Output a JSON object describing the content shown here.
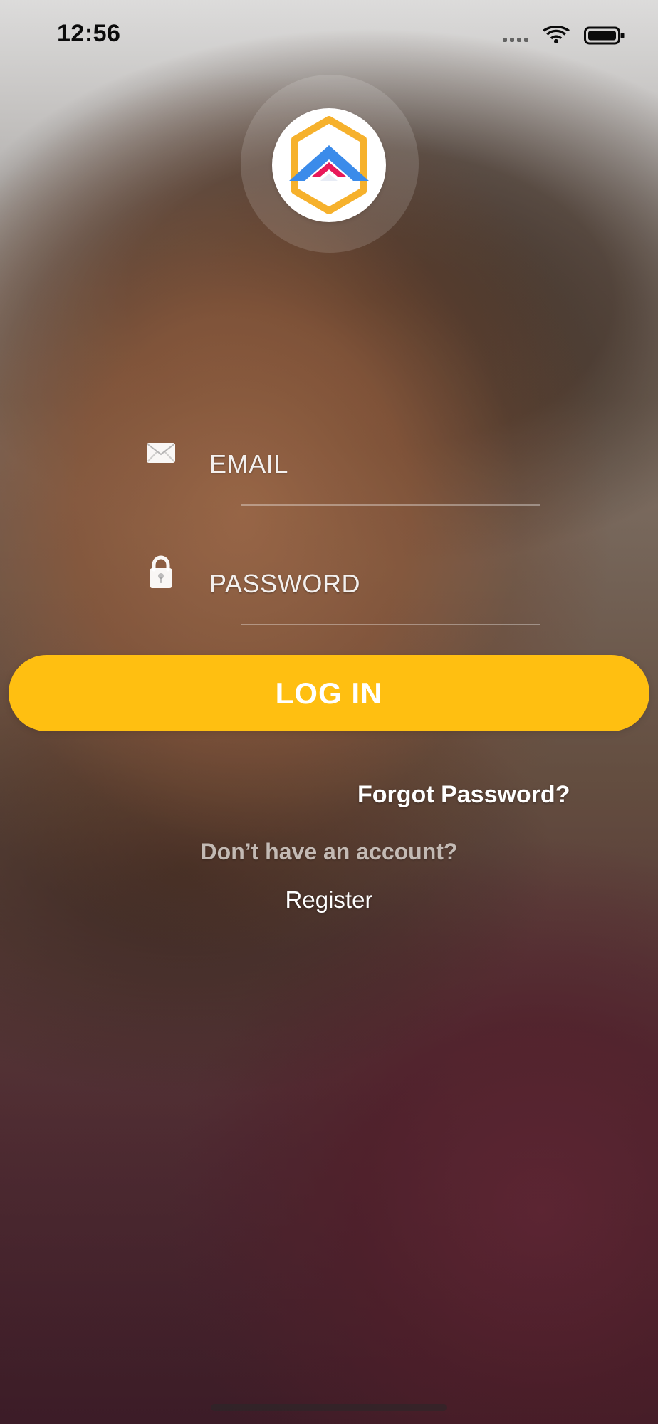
{
  "status_bar": {
    "time": "12:56",
    "icons": [
      "signal-dots-icon",
      "wifi-icon",
      "battery-icon"
    ]
  },
  "branding": {
    "logo": "app-logo",
    "colors": {
      "gold": "#F6B12C",
      "blue": "#3B8BEA",
      "pink": "#E8195A"
    }
  },
  "form": {
    "email": {
      "icon": "envelope-icon",
      "placeholder": "EMAIL",
      "value": ""
    },
    "password": {
      "icon": "lock-icon",
      "placeholder": "PASSWORD",
      "value": ""
    },
    "login_label": "LOG IN",
    "accent_color": "#FFBF11"
  },
  "links": {
    "forgot_password": "Forgot Password?",
    "no_account_text": "Don’t have an account?",
    "register": "Register"
  }
}
